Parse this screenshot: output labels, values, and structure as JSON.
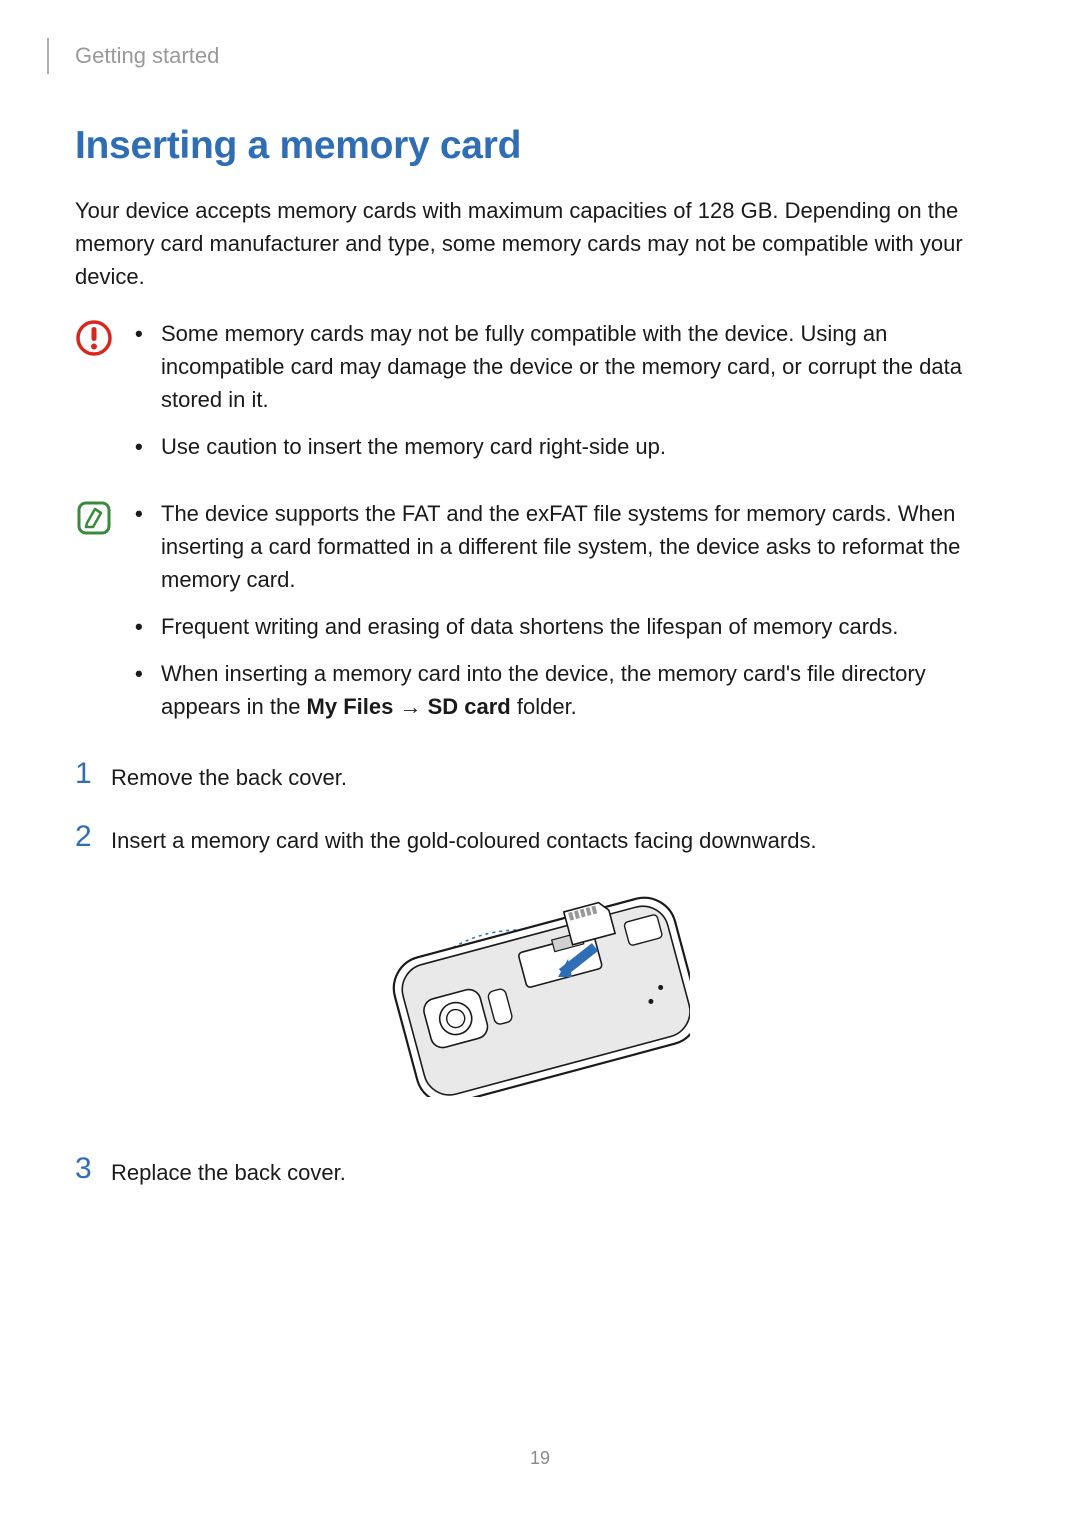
{
  "header": {
    "section": "Getting started"
  },
  "title": "Inserting a memory card",
  "intro": "Your device accepts memory cards with maximum capacities of 128 GB. Depending on the memory card manufacturer and type, some memory cards may not be compatible with your device.",
  "warning": {
    "items": [
      "Some memory cards may not be fully compatible with the device. Using an incompatible card may damage the device or the memory card, or corrupt the data stored in it.",
      "Use caution to insert the memory card right-side up."
    ]
  },
  "note": {
    "items": [
      "The device supports the FAT and the exFAT file systems for memory cards. When inserting a card formatted in a different file system, the device asks to reformat the memory card.",
      "Frequent writing and erasing of data shortens the lifespan of memory cards."
    ],
    "last_prefix": "When inserting a memory card into the device, the memory card's file directory appears in the ",
    "last_bold1": "My Files",
    "last_arrow": " → ",
    "last_bold2": "SD card",
    "last_suffix": " folder."
  },
  "steps": {
    "s1": {
      "num": "1",
      "text": "Remove the back cover."
    },
    "s2": {
      "num": "2",
      "text": "Insert a memory card with the gold-coloured contacts facing downwards."
    },
    "s3": {
      "num": "3",
      "text": "Replace the back cover."
    }
  },
  "icons": {
    "warning": "warning-icon",
    "note": "note-icon"
  },
  "page_number": "19"
}
